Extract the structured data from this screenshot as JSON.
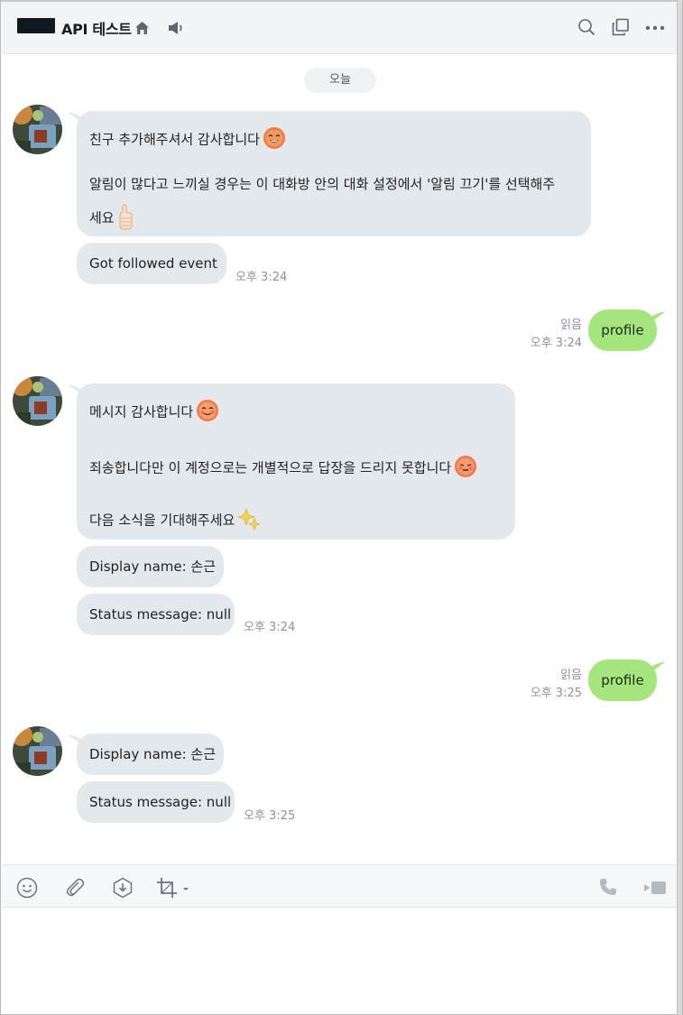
{
  "header": {
    "title": "API 테스트",
    "icons": [
      "home-icon",
      "speaker-icon",
      "search-icon",
      "popout-icon",
      "more-icon"
    ]
  },
  "chat": {
    "date_divider": "오늘",
    "messages": [
      {
        "sender": "bot",
        "lines": [
          "친구 추가해주셔서 감사합니다",
          "",
          "알림이 많다고 느끼실 경우는 이 대화방 안의 대화 설정에서 '알림 끄기'를 선택해주",
          "세요"
        ]
      },
      {
        "sender": "bot",
        "text": "Got followed event",
        "time": "오후 3:24"
      },
      {
        "sender": "me",
        "text": "profile",
        "read": "읽음",
        "time": "오후 3:24"
      },
      {
        "sender": "bot",
        "lines": [
          "메시지 감사합니다",
          "죄송합니다만 이 계정으로는 개별적으로 답장을 드리지 못합니다",
          "다음 소식을 기대해주세요"
        ]
      },
      {
        "sender": "bot",
        "text": "Display name: 손근"
      },
      {
        "sender": "bot",
        "text": "Status message: null",
        "time": "오후 3:24"
      },
      {
        "sender": "me",
        "text": "profile",
        "read": "읽음",
        "time": "오후 3:25"
      },
      {
        "sender": "bot",
        "text": "Display name: 손근"
      },
      {
        "sender": "bot",
        "text": "Status message: null",
        "time": "오후 3:25"
      }
    ]
  },
  "toolbar": {
    "icons": [
      "emoji-icon",
      "attach-icon",
      "save-icon",
      "crop-icon",
      "call-icon",
      "video-icon"
    ]
  },
  "colors": {
    "my_bubble": "#a4e57e",
    "bot_bubble": "#e3e8ec",
    "header_bg": "#f2f4f6"
  }
}
